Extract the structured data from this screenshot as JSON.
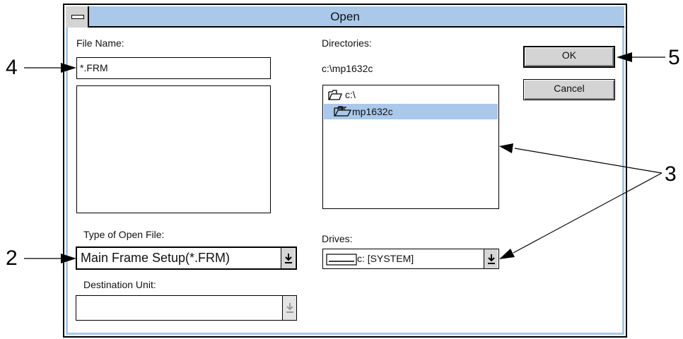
{
  "dialog": {
    "title": "Open"
  },
  "file_name": {
    "label": "File Name:",
    "value": "*.FRM"
  },
  "directories": {
    "label": "Directories:",
    "current_path": "c:\\mp1632c",
    "items": [
      {
        "label": "c:\\",
        "icon": "open-folder-icon",
        "selected": false
      },
      {
        "label": "mp1632c",
        "icon": "open-folder-files-icon",
        "selected": true
      }
    ]
  },
  "buttons": {
    "ok_label": "OK",
    "cancel_label": "Cancel"
  },
  "type_of_open_file": {
    "label": "Type of Open File:",
    "value": "Main Frame Setup(*.FRM)"
  },
  "drives": {
    "label": "Drives:",
    "value": "c: [SYSTEM]",
    "icon": "drive-icon"
  },
  "destination_unit": {
    "label": "Destination Unit:",
    "value": ""
  },
  "callouts": {
    "c2": "2",
    "c3": "3",
    "c4": "4",
    "c5": "5"
  },
  "colors": {
    "title_bar": "#a9c8ea",
    "selection": "#a9c8ea",
    "button_face": "#d4d4d4"
  }
}
